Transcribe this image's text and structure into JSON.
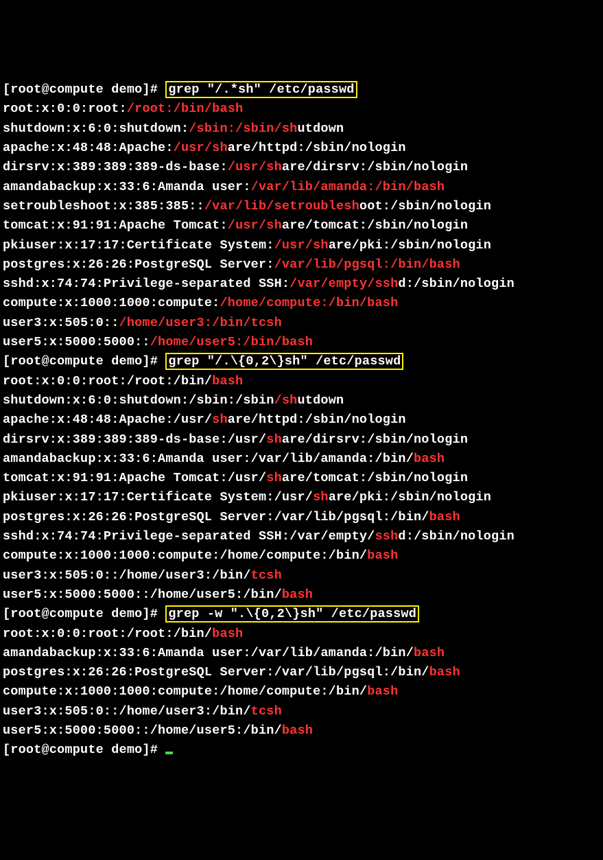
{
  "prompt": "[root@compute demo]# ",
  "cmds": [
    {
      "cmd": "grep \"/.*sh\" /etc/passwd"
    },
    {
      "cmd": "grep \"/.\\{0,2\\}sh\" /etc/passwd"
    },
    {
      "cmd": "grep -w \".\\{0,2\\}sh\" /etc/passwd"
    }
  ],
  "block1": [
    [
      [
        "root:x:0:0:root:",
        0
      ],
      [
        "/root:/bin/bash",
        1
      ]
    ],
    [
      [
        "shutdown:x:6:0:shutdown:",
        0
      ],
      [
        "/sbin:/sbin/sh",
        1
      ],
      [
        "utdown",
        0
      ]
    ],
    [
      [
        "apache:x:48:48:Apache:",
        0
      ],
      [
        "/usr/sh",
        1
      ],
      [
        "are/httpd:/sbin/nologin",
        0
      ]
    ],
    [
      [
        "dirsrv:x:389:389:389-ds-base:",
        0
      ],
      [
        "/usr/sh",
        1
      ],
      [
        "are/dirsrv:/sbin/nologin",
        0
      ]
    ],
    [
      [
        "amandabackup:x:33:6:Amanda user:",
        0
      ],
      [
        "/var/lib/amanda:/bin/bash",
        1
      ]
    ],
    [
      [
        "setroubleshoot:x:385:385::",
        0
      ],
      [
        "/var/lib/setroublesh",
        1
      ],
      [
        "oot:/sbin/nologin",
        0
      ]
    ],
    [
      [
        "tomcat:x:91:91:Apache Tomcat:",
        0
      ],
      [
        "/usr/sh",
        1
      ],
      [
        "are/tomcat:/sbin/nologin",
        0
      ]
    ],
    [
      [
        "pkiuser:x:17:17:Certificate System:",
        0
      ],
      [
        "/usr/sh",
        1
      ],
      [
        "are/pki:/sbin/nologin",
        0
      ]
    ],
    [
      [
        "postgres:x:26:26:PostgreSQL Server:",
        0
      ],
      [
        "/var/lib/pgsql:/bin/bash",
        1
      ]
    ],
    [
      [
        "sshd:x:74:74:Privilege-separated SSH:",
        0
      ],
      [
        "/var/empty/ssh",
        1
      ],
      [
        "d:/sbin/nologin",
        0
      ]
    ],
    [
      [
        "compute:x:1000:1000:compute:",
        0
      ],
      [
        "/home/compute:/bin/bash",
        1
      ]
    ],
    [
      [
        "user3:x:505:0::",
        0
      ],
      [
        "/home/user3:/bin/tcsh",
        1
      ]
    ],
    [
      [
        "user5:x:5000:5000::",
        0
      ],
      [
        "/home/user5:/bin/bash",
        1
      ]
    ]
  ],
  "block2": [
    [
      [
        "root:x:0:0:root:/root:/bin/",
        0
      ],
      [
        "bash",
        1
      ]
    ],
    [
      [
        "shutdown:x:6:0:shutdown:/sbin:/sbin",
        0
      ],
      [
        "/sh",
        1
      ],
      [
        "utdown",
        0
      ]
    ],
    [
      [
        "apache:x:48:48:Apache:/usr/",
        0
      ],
      [
        "sh",
        1
      ],
      [
        "are/httpd:/sbin/nologin",
        0
      ]
    ],
    [
      [
        "dirsrv:x:389:389:389-ds-base:/usr/",
        0
      ],
      [
        "sh",
        1
      ],
      [
        "are/dirsrv:/sbin/nologin",
        0
      ]
    ],
    [
      [
        "amandabackup:x:33:6:Amanda user:/var/lib/amanda:/bin/",
        0
      ],
      [
        "bash",
        1
      ]
    ],
    [
      [
        "tomcat:x:91:91:Apache Tomcat:/usr/",
        0
      ],
      [
        "sh",
        1
      ],
      [
        "are/tomcat:/sbin/nologin",
        0
      ]
    ],
    [
      [
        "pkiuser:x:17:17:Certificate System:/usr/",
        0
      ],
      [
        "sh",
        1
      ],
      [
        "are/pki:/sbin/nologin",
        0
      ]
    ],
    [
      [
        "postgres:x:26:26:PostgreSQL Server:/var/lib/pgsql:/bin/",
        0
      ],
      [
        "bash",
        1
      ]
    ],
    [
      [
        "sshd:x:74:74:Privilege-separated SSH:/var/empty/",
        0
      ],
      [
        "ssh",
        1
      ],
      [
        "d:/sbin/nologin",
        0
      ]
    ],
    [
      [
        "compute:x:1000:1000:compute:/home/compute:/bin/",
        0
      ],
      [
        "bash",
        1
      ]
    ],
    [
      [
        "user3:x:505:0::/home/user3:/bin/",
        0
      ],
      [
        "tcsh",
        1
      ]
    ],
    [
      [
        "user5:x:5000:5000::/home/user5:/bin/",
        0
      ],
      [
        "bash",
        1
      ]
    ]
  ],
  "block3": [
    [
      [
        "root:x:0:0:root:/root:/bin/",
        0
      ],
      [
        "bash",
        1
      ]
    ],
    [
      [
        "amandabackup:x:33:6:Amanda user:/var/lib/amanda:/bin/",
        0
      ],
      [
        "bash",
        1
      ]
    ],
    [
      [
        "postgres:x:26:26:PostgreSQL Server:/var/lib/pgsql:/bin/",
        0
      ],
      [
        "bash",
        1
      ]
    ],
    [
      [
        "compute:x:1000:1000:compute:/home/compute:/bin/",
        0
      ],
      [
        "bash",
        1
      ]
    ],
    [
      [
        "user3:x:505:0::/home/user3:/bin/",
        0
      ],
      [
        "tcsh",
        1
      ]
    ],
    [
      [
        "user5:x:5000:5000::/home/user5:/bin/",
        0
      ],
      [
        "bash",
        1
      ]
    ]
  ]
}
